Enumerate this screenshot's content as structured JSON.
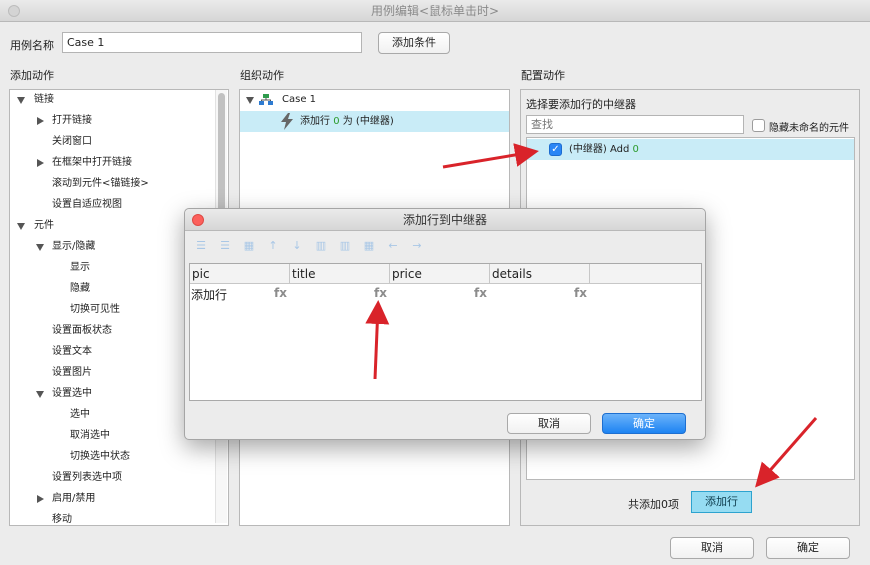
{
  "window": {
    "title": "用例编辑<鼠标单击时>"
  },
  "case_name": {
    "label": "用例名称",
    "value": "Case 1",
    "add_condition_button": "添加条件"
  },
  "columns": {
    "add_actions": "添加动作",
    "organize_actions": "组织动作",
    "configure_actions": "配置动作"
  },
  "actions_tree": [
    {
      "label": "链接",
      "toggle": "down"
    },
    {
      "label": "打开链接",
      "toggle": "right"
    },
    {
      "label": "关闭窗口",
      "toggle": ""
    },
    {
      "label": "在框架中打开链接",
      "toggle": "right"
    },
    {
      "label": "滚动到元件<锚链接>",
      "toggle": ""
    },
    {
      "label": "设置自适应视图",
      "toggle": ""
    },
    {
      "label": "元件",
      "toggle": "down"
    },
    {
      "label": "显示/隐藏",
      "toggle": "down"
    },
    {
      "label": "显示",
      "toggle": ""
    },
    {
      "label": "隐藏",
      "toggle": ""
    },
    {
      "label": "切换可见性",
      "toggle": ""
    },
    {
      "label": "设置面板状态",
      "toggle": ""
    },
    {
      "label": "设置文本",
      "toggle": ""
    },
    {
      "label": "设置图片",
      "toggle": ""
    },
    {
      "label": "设置选中",
      "toggle": "down"
    },
    {
      "label": "选中",
      "toggle": ""
    },
    {
      "label": "取消选中",
      "toggle": ""
    },
    {
      "label": "切换选中状态",
      "toggle": ""
    },
    {
      "label": "设置列表选中项",
      "toggle": ""
    },
    {
      "label": "启用/禁用",
      "toggle": "right"
    },
    {
      "label": "移动",
      "toggle": ""
    }
  ],
  "organize": {
    "case_label": "Case 1",
    "action_prefix": "添加行",
    "action_count": "0",
    "action_suffix": "为 (中继器)"
  },
  "configure": {
    "heading": "选择要添加行的中继器",
    "search_placeholder": "查找",
    "hide_unnamed_label": "隐藏未命名的元件",
    "repeater_item_name": "(中继器) Add",
    "repeater_item_count": "0",
    "total_label": "共添加0项",
    "add_row_button": "添加行"
  },
  "footer": {
    "cancel": "取消",
    "ok": "确定"
  },
  "dialog": {
    "title": "添加行到中继器",
    "columns": [
      "pic",
      "title",
      "price",
      "details"
    ],
    "row_label": "添加行",
    "fx_label": "fx",
    "cancel": "取消",
    "ok": "确定"
  },
  "colors": {
    "selection": "#c9ecf7",
    "primary": "#1d83f2",
    "annotation_arrow": "#d9232a",
    "count_green": "#2c9b2c"
  }
}
